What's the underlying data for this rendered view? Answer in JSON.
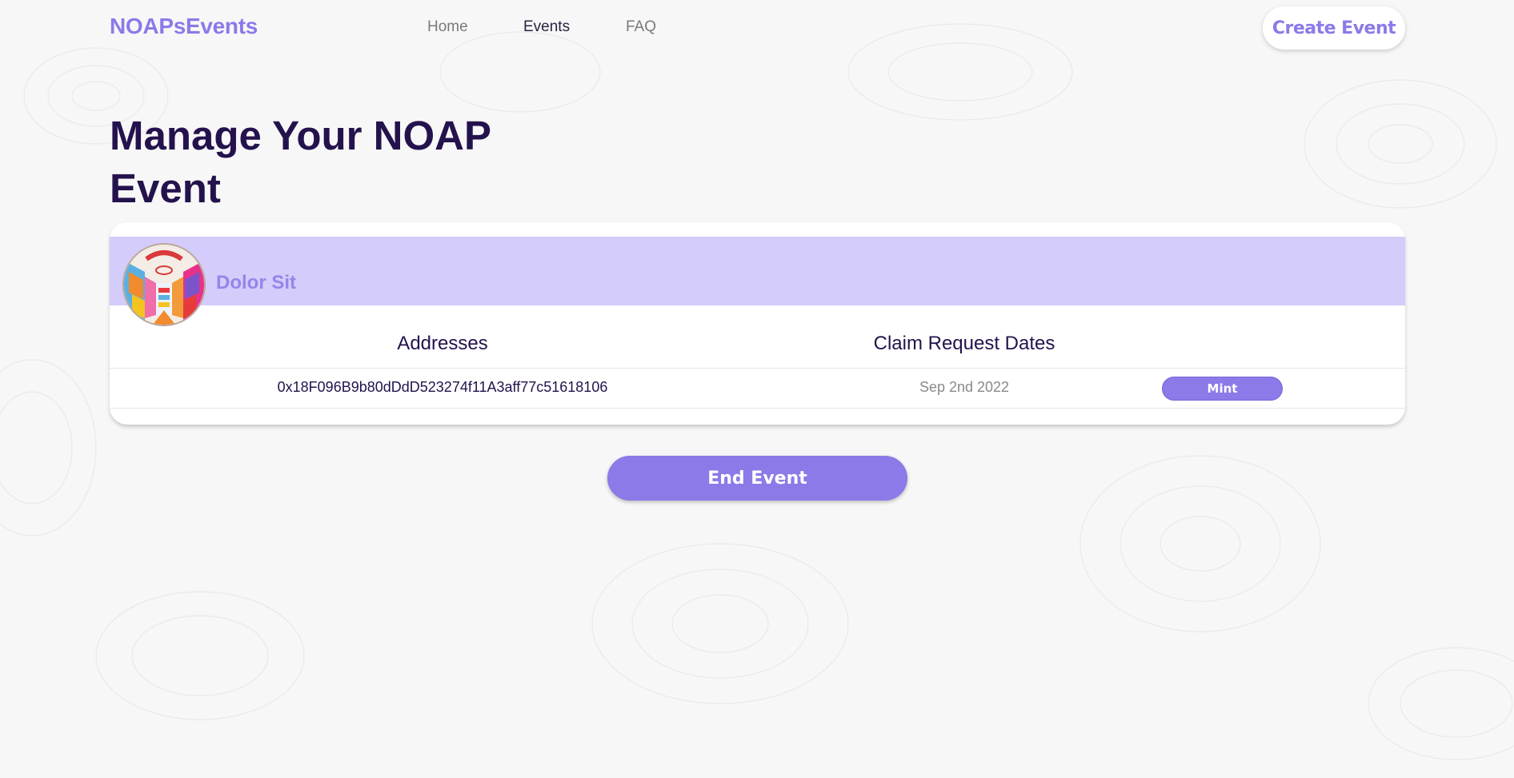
{
  "header": {
    "logo": "NOAPsEvents",
    "nav": [
      {
        "label": "Home",
        "active": false
      },
      {
        "label": "Events",
        "active": true
      },
      {
        "label": "FAQ",
        "active": false
      }
    ],
    "create_button": "Create Event"
  },
  "main": {
    "title": "Manage Your NOAP Event",
    "event": {
      "name": "Dolor Sit",
      "avatar_icon": "art-basel-event-badge"
    },
    "table": {
      "columns": [
        "Addresses",
        "Claim Request Dates"
      ],
      "rows": [
        {
          "address": "0x18F096B9b80dDdD523274f11A3aff77c51618106",
          "date": "Sep 2nd 2022",
          "action": "Mint"
        }
      ]
    },
    "end_button": "End Event"
  },
  "colors": {
    "accent": "#8b7ae8",
    "header_band": "#d4ccfa",
    "title": "#24124d",
    "background": "#f7f7f7"
  }
}
